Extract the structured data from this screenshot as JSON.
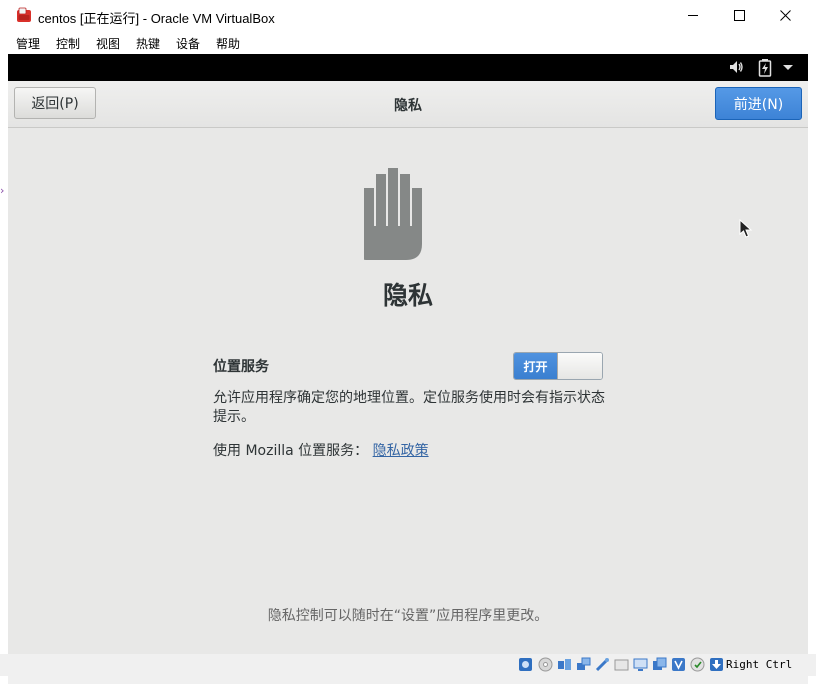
{
  "window": {
    "title": "centos [正在运行] - Oracle VM VirtualBox"
  },
  "menubar": {
    "items": [
      "管理",
      "控制",
      "视图",
      "热键",
      "设备",
      "帮助"
    ]
  },
  "header": {
    "back_label": "返回(P)",
    "title": "隐私",
    "next_label": "前进(N)",
    "accent": "#3d83d6"
  },
  "privacy": {
    "heading": "隐私",
    "location_label": "位置服务",
    "toggle_state": "打开",
    "description": "允许应用程序确定您的地理位置。定位服务使用时会有指示状态提示。",
    "mozilla_prefix": "使用  Mozilla 位置服务：",
    "policy_link": "隐私政策",
    "footer_note": "隐私控制可以随时在“设置”应用程序里更改。"
  },
  "statusbar": {
    "host_key": "Right Ctrl",
    "icons": [
      "hard-disk-icon",
      "optical-drive-icon",
      "audio-icon",
      "network-icon",
      "usb-icon",
      "shared-folders-icon",
      "display-icon",
      "video-capture-icon",
      "vbox-icon",
      "mouse-integration-icon",
      "keyboard-icon"
    ]
  }
}
